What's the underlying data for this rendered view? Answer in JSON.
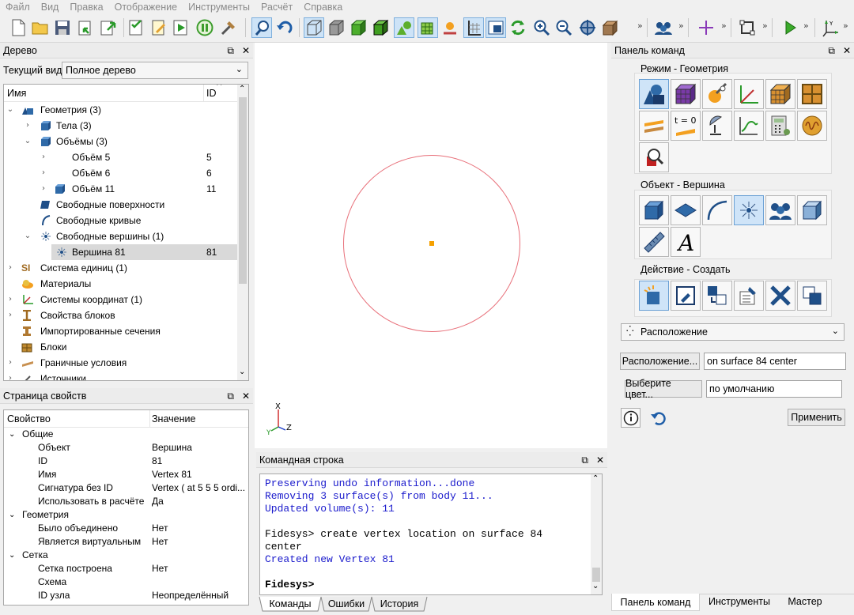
{
  "menu": [
    "Файл",
    "Вид",
    "Правка",
    "Отображение",
    "Инструменты",
    "Расчёт",
    "Справка"
  ],
  "tree_panel": {
    "title": "Дерево",
    "current_view_label": "Текущий вид",
    "current_view_value": "Полное дерево",
    "col_name": "Имя",
    "col_id": "ID",
    "rows": [
      {
        "label": "Геометрия (3)",
        "id": ""
      },
      {
        "label": "Тела (3)",
        "id": ""
      },
      {
        "label": "Объёмы (3)",
        "id": ""
      },
      {
        "label": "Объём 5",
        "id": "5"
      },
      {
        "label": "Объём 6",
        "id": "6"
      },
      {
        "label": "Объём 11",
        "id": "11"
      },
      {
        "label": "Свободные поверхности",
        "id": ""
      },
      {
        "label": "Свободные кривые",
        "id": ""
      },
      {
        "label": "Свободные вершины (1)",
        "id": ""
      },
      {
        "label": "Вершина 81",
        "id": "81"
      },
      {
        "label": "Система единиц (1)",
        "id": ""
      },
      {
        "label": "Материалы",
        "id": ""
      },
      {
        "label": "Системы координат (1)",
        "id": ""
      },
      {
        "label": "Свойства блоков",
        "id": ""
      },
      {
        "label": "Импортированные сечения",
        "id": ""
      },
      {
        "label": "Блоки",
        "id": ""
      },
      {
        "label": "Граничные условия",
        "id": ""
      },
      {
        "label": "Источники",
        "id": ""
      }
    ]
  },
  "props_panel": {
    "title": "Страница свойств",
    "col_prop": "Свойство",
    "col_value": "Значение",
    "rows": [
      {
        "k": "Общие",
        "v": ""
      },
      {
        "k": "Объект",
        "v": "Вершина"
      },
      {
        "k": "ID",
        "v": "81"
      },
      {
        "k": "Имя",
        "v": "Vertex 81"
      },
      {
        "k": "Сигнатура без ID",
        "v": "Vertex ( at 5 5 5 ordi..."
      },
      {
        "k": "Использовать в расчёте",
        "v": "Да"
      },
      {
        "k": "Геометрия",
        "v": ""
      },
      {
        "k": "Было объединено",
        "v": "Нет"
      },
      {
        "k": "Является виртуальным",
        "v": "Нет"
      },
      {
        "k": "Сетка",
        "v": ""
      },
      {
        "k": "Сетка построена",
        "v": "Нет"
      },
      {
        "k": "Схема",
        "v": ""
      },
      {
        "k": "ID узла",
        "v": "Неопределённый"
      }
    ]
  },
  "viewport": {
    "axis_x": "X",
    "axis_y": "Y",
    "axis_z": "Z",
    "circle_color": "#e8707a",
    "vertex_color": "#f5a000"
  },
  "console": {
    "title": "Командная строка",
    "lines": [
      {
        "text": "Preserving undo information...done",
        "color": "#1a1acc"
      },
      {
        "text": "Removing 3 surface(s) from body 11...",
        "color": "#1a1acc"
      },
      {
        "text": "Updated volume(s): 11",
        "color": "#1a1acc"
      },
      {
        "text": "",
        "color": "#000"
      },
      {
        "text": "Fidesys> create vertex location on surface 84",
        "color": "#000"
      },
      {
        "text": "center",
        "color": "#000"
      },
      {
        "text": "Created new Vertex 81",
        "color": "#1a1acc"
      },
      {
        "text": "",
        "color": "#000"
      },
      {
        "text": "Fidesys>",
        "color": "#000"
      }
    ],
    "tabs": [
      "Команды",
      "Ошибки",
      "История"
    ]
  },
  "command_panel": {
    "title": "Панель команд",
    "group_mode": "Режим - Геометрия",
    "group_object": "Объект - Вершина",
    "group_action": "Действие - Создать",
    "method_dropdown": "Расположение",
    "location_button": "Расположение...",
    "location_value": "on surface 84 center",
    "color_button": "Выберите цвет...",
    "color_value": "по умолчанию",
    "apply_button": "Применить",
    "bottom_tabs": [
      "Панель команд",
      "Инструменты",
      "Мастер"
    ],
    "t0_label": "t = 0"
  },
  "colors": {
    "accent": "#3f86c8",
    "selection": "#cde3f7",
    "console_blue": "#1a1acc"
  }
}
